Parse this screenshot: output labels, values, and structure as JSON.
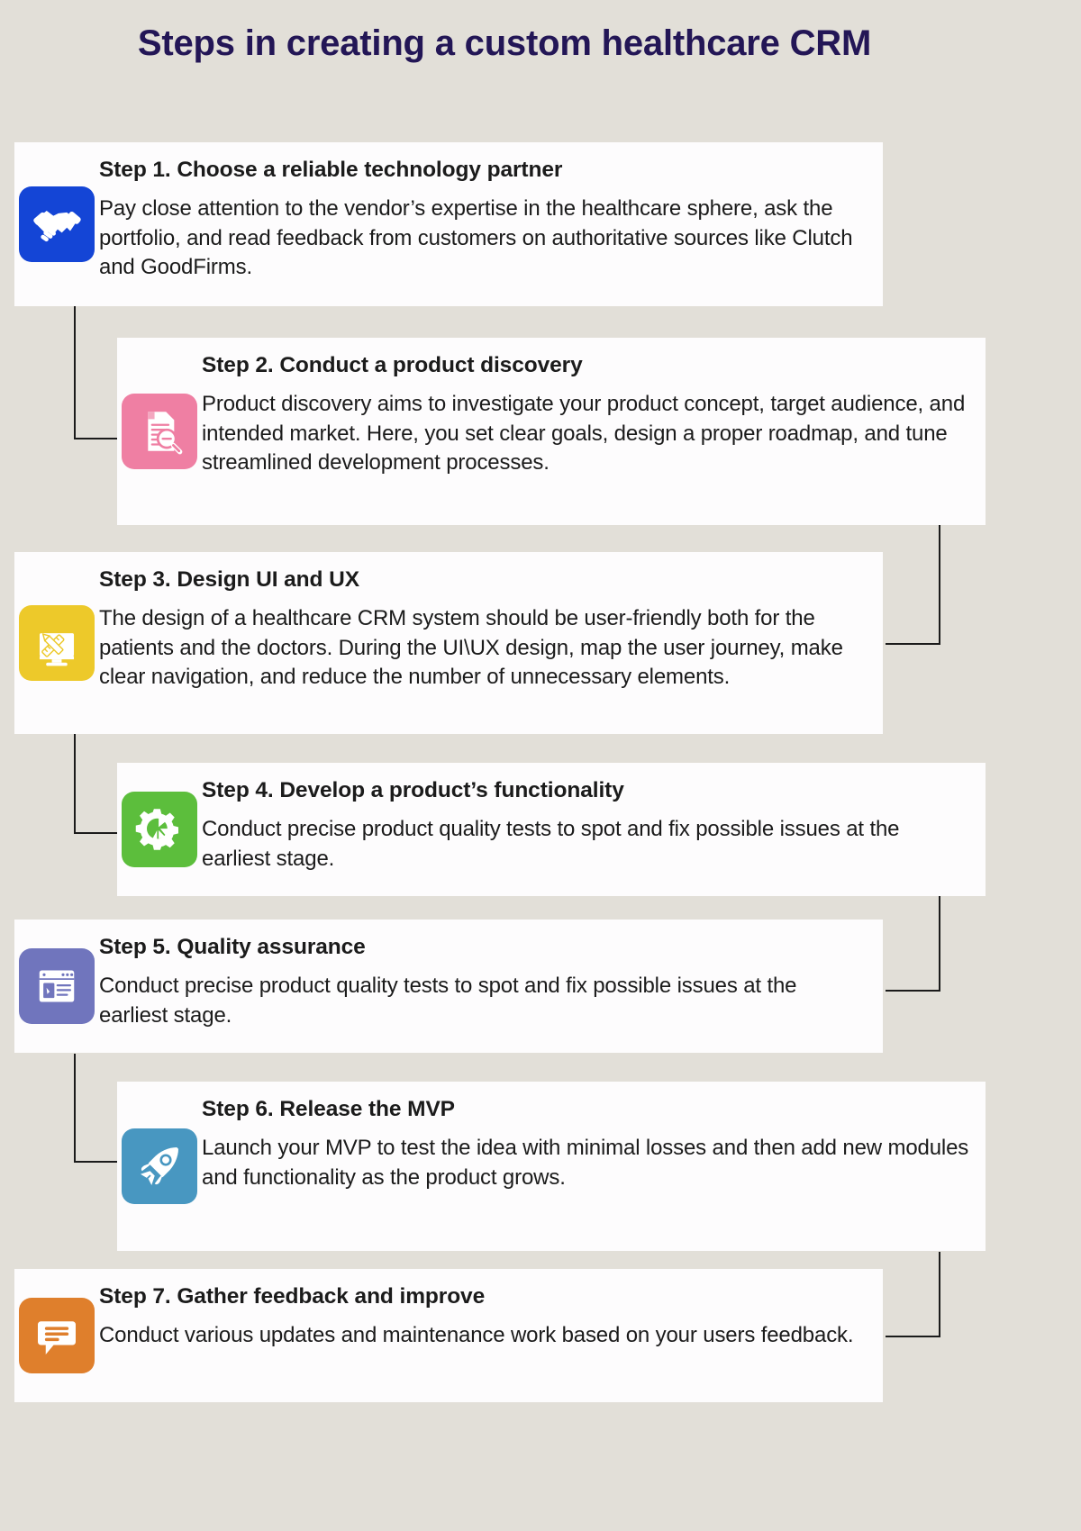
{
  "title": "Steps in creating a custom healthcare CRM",
  "colors": {
    "background": "#e2dfd8",
    "card_background": "#fdfcfd",
    "title_text": "#231656",
    "body_text": "#1b1b1b",
    "connector": "#1b1b1b",
    "step1_icon": "#1445d6",
    "step2_icon": "#ef7fa3",
    "step3_icon": "#edc92a",
    "step4_icon": "#5cbe3c",
    "step5_icon": "#7075bd",
    "step6_icon": "#4897c1",
    "step7_icon": "#df7f2c"
  },
  "steps": [
    {
      "number": 1,
      "align": "left",
      "heading": "Step 1. Choose a reliable technology partner",
      "text": "Pay close attention to the vendor’s expertise in the healthcare sphere, ask the portfolio, and read feedback from customers on authoritative sources like Clutch and GoodFirms.",
      "icon": "handshake-icon",
      "icon_color": "#1445d6"
    },
    {
      "number": 2,
      "align": "right",
      "heading": "Step 2. Conduct a product discovery",
      "text": "Product discovery aims to investigate your product concept, target audience, and intended market. Here, you set clear goals, design a proper roadmap, and tune streamlined development processes.",
      "icon": "document-search-icon",
      "icon_color": "#ef7fa3"
    },
    {
      "number": 3,
      "align": "left",
      "heading": "Step 3. Design UI and UX",
      "text": "The design of a healthcare CRM system should be user-friendly both for the patients and the doctors. During the UI\\UX design, map the user journey, make clear navigation, and reduce the number of unnecessary elements.",
      "icon": "design-monitor-icon",
      "icon_color": "#edc92a"
    },
    {
      "number": 4,
      "align": "right",
      "heading": "Step 4. Develop a product’s functionality",
      "text": "Conduct precise product quality tests to spot and fix possible issues at the earliest stage.",
      "icon": "gear-chart-icon",
      "icon_color": "#5cbe3c"
    },
    {
      "number": 5,
      "align": "left",
      "heading": "Step 5. Quality assurance",
      "text": "Conduct precise product quality tests to spot and fix possible issues at the earliest stage.",
      "icon": "browser-window-icon",
      "icon_color": "#7075bd"
    },
    {
      "number": 6,
      "align": "right",
      "heading": "Step 6. Release the MVP",
      "text": "Launch your MVP to test the idea with minimal losses and then add new modules and functionality as the product grows.",
      "icon": "rocket-icon",
      "icon_color": "#4897c1"
    },
    {
      "number": 7,
      "align": "left",
      "heading": "Step 7. Gather feedback and improve",
      "text": "Conduct various updates and maintenance work based on your users feedback.",
      "icon": "chat-bubble-icon",
      "icon_color": "#df7f2c"
    }
  ]
}
